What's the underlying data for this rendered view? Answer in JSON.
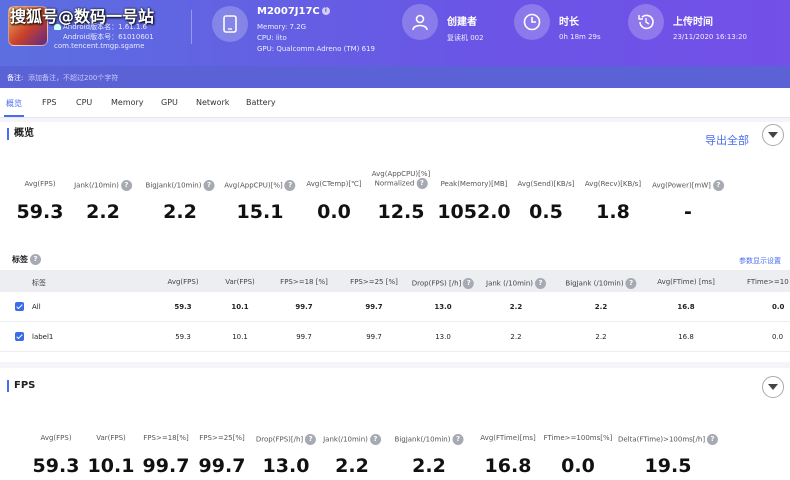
{
  "watermark": "搜狐号@数码一号站",
  "app": {
    "android_version": "Android版本名：1.61.1.6",
    "android_code": "Android版本号：61010601",
    "package": "com.tencent.tmgp.sgame"
  },
  "device": {
    "name": "M2007J17C",
    "memory": "Memory: 7.2G",
    "cpu": "CPU: lito",
    "gpu": "GPU: Qualcomm Adreno (TM) 619"
  },
  "creator": {
    "label": "创建者",
    "value": "复读机 002"
  },
  "duration": {
    "label": "时长",
    "value": "0h 18m 29s"
  },
  "upload": {
    "label": "上传时间",
    "value": "23/11/2020 16:13:20"
  },
  "note": {
    "label": "备注:",
    "placeholder": "添加备注，不超过200个字符"
  },
  "tabs": [
    "概览",
    "FPS",
    "CPU",
    "Memory",
    "GPU",
    "Network",
    "Battery"
  ],
  "overview": {
    "title": "概览",
    "export": "导出全部",
    "stats": [
      {
        "label": "Avg(FPS)",
        "value": "59.3"
      },
      {
        "label": "Jank(/10min)",
        "value": "2.2"
      },
      {
        "label": "BigJank(/10min)",
        "value": "2.2"
      },
      {
        "label": "Avg(AppCPU)[%]",
        "value": "15.1"
      },
      {
        "label": "Avg(CTemp)[℃]",
        "value": "0.0"
      },
      {
        "label": "Avg(AppCPU)[%]",
        "label2": "Normalized",
        "value": "12.5"
      },
      {
        "label": "Peak(Memory)[MB]",
        "value": "1052.0"
      },
      {
        "label": "Avg(Send)[KB/s]",
        "value": "0.5"
      },
      {
        "label": "Avg(Recv)[KB/s]",
        "value": "1.8"
      },
      {
        "label": "Avg(Power)[mW]",
        "value": "-"
      }
    ]
  },
  "tags": {
    "title": "标签",
    "settings": "参数显示设置",
    "headers": [
      "标签",
      "Avg(FPS)",
      "Var(FPS)",
      "FPS>=18 [%]",
      "FPS>=25 [%]",
      "Drop(FPS) [/h]",
      "Jank (/10min)",
      "BigJank (/10min)",
      "Avg(FTime) [ms]",
      "FTime>=10"
    ],
    "rows": [
      {
        "name": "All",
        "cells": [
          "59.3",
          "10.1",
          "99.7",
          "99.7",
          "13.0",
          "2.2",
          "2.2",
          "16.8",
          "0.0"
        ]
      },
      {
        "name": "label1",
        "cells": [
          "59.3",
          "10.1",
          "99.7",
          "99.7",
          "13.0",
          "2.2",
          "2.2",
          "16.8",
          "0.0"
        ]
      }
    ]
  },
  "fps": {
    "title": "FPS",
    "stats": [
      {
        "label": "Avg(FPS)",
        "value": "59.3"
      },
      {
        "label": "Var(FPS)",
        "value": "10.1"
      },
      {
        "label": "FPS>=18[%]",
        "value": "99.7"
      },
      {
        "label": "FPS>=25[%]",
        "value": "99.7"
      },
      {
        "label": "Drop(FPS)[/h]",
        "value": "13.0"
      },
      {
        "label": "Jank(/10min)",
        "value": "2.2"
      },
      {
        "label": "BigJank(/10min)",
        "value": "2.2"
      },
      {
        "label": "Avg(FTime)[ms]",
        "value": "16.8"
      },
      {
        "label": "FTime>=100ms[%]",
        "value": "0.0"
      },
      {
        "label": "Delta(FTime)>100ms[/h]",
        "value": "19.5"
      }
    ]
  }
}
